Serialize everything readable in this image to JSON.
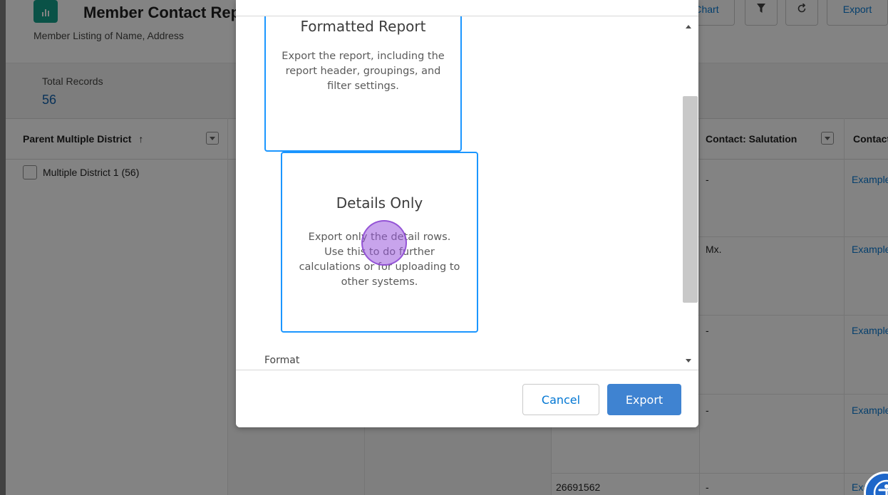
{
  "report": {
    "title": "Member Contact Report",
    "subtitle": "Member Listing of Name, Address",
    "toolbar": {
      "chart_label": "Chart",
      "export_label": "Export"
    },
    "summary": {
      "label": "Total Records",
      "value": "56"
    },
    "columns": {
      "group_col": "Parent Multiple District",
      "sort_indicator": "↑",
      "salutation_col": "Contact: Salutation",
      "contact_col": "Contact"
    },
    "group_row": "Multiple District 1 (56)",
    "rows": [
      {
        "salutation": "-",
        "contact": "Example"
      },
      {
        "salutation": "Mx.",
        "contact": "Example"
      },
      {
        "salutation": "-",
        "contact": "Example"
      },
      {
        "salutation": "-",
        "contact": "Example"
      },
      {
        "id": "26691562",
        "salutation": "-",
        "contact": "Example"
      }
    ]
  },
  "modal": {
    "options": [
      {
        "title": "Formatted Report",
        "description": "Export the report, including the report header, groupings, and filter settings."
      },
      {
        "title": "Details Only",
        "description": "Export only the detail rows. Use this to do further calculations or for uploading to other systems."
      }
    ],
    "format_label": "Format",
    "cancel_label": "Cancel",
    "export_label": "Export"
  },
  "colors": {
    "brand_blue": "#0176d3",
    "card_border": "#1b96ff",
    "export_button": "#3f83d1",
    "report_icon": "#0c9d87",
    "click_marker": "#9b5adc"
  }
}
